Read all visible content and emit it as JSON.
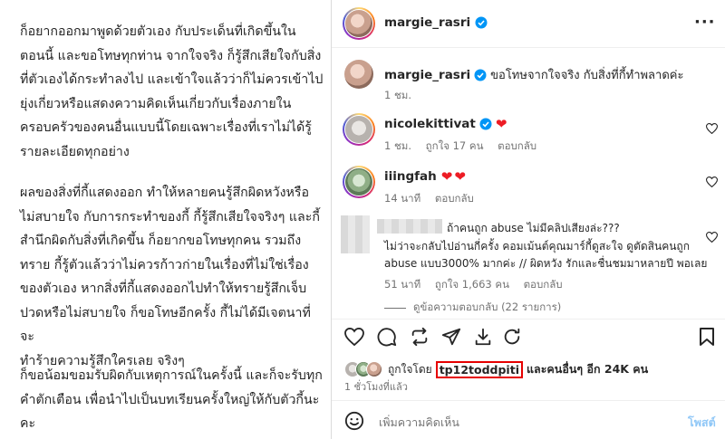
{
  "caption": {
    "paragraphs": [
      "ก็อยากออกมาพูดด้วยตัวเอง  กับประเด็นที่เกิดขึ้นใน\nตอนนี้ และขอโทษทุกท่าน จากใจจริง ก็รู้สึกเสียใจกับสิ่ง\nที่ตัวเองได้กระทำลงไป และเข้าใจแล้วว่าก็ไม่ควรเข้าไป\nยุ่งเกี่ยวหรือแสดงความคิดเห็นเกี่ยวกับเรื่องภายใน\nครอบครัวของคนอื่นแบบนี้โดยเฉพาะเรื่องที่เราไม่ได้รู้\nรายละเอียดทุกอย่าง",
      "ผลของสิ่งที่กี้แสดงออก ทำให้หลายคนรู้สึกผิดหวังหรือ\nไม่สบายใจ กับการกระทำของกี้  กี้รู้สึกเสียใจจริงๆ และกี้\nสำนึกผิดกับสิ่งที่เกิดขึ้น ก็อยากขอโทษทุกคน รวมถึง\nทราย กี้รู้ตัวแล้วว่าไม่ควรก้าวก่ายในเรื่องที่ไม่ใช่เรื่อง\nของตัวเอง หากสิ่งที่กี้แสดงออกไปทำให้ทรายรู้สึกเจ็บ\nปวดหรือไม่สบายใจ ก็ขอโทษอีกครั้ง กี้ไม่ได้มีเจตนาที่จะ\nทำร้ายความรู้สึกใครเลย จริงๆ",
      "ก็ขอน้อมขอมรับผิดกับเหตุการณ์ในครั้งนี้ และก็จะรับทุก\nคำตักเตือน เพื่อนำไปเป็นบทเรียนครั้งใหญ่ให้กับตัวกี้นะ\nคะ"
    ]
  },
  "header": {
    "username": "margie_rasri",
    "more_label": "···"
  },
  "post_caption": {
    "username": "margie_rasri",
    "text": "ขอโทษจากใจจริง กับสิ่งที่กี้ทำพลาดค่ะ",
    "time": "1 ชม."
  },
  "comments": [
    {
      "username": "nicolekittivat",
      "text": "❤",
      "time": "1 ชม.",
      "likes": "ถูกใจ 17 คน",
      "reply": "ตอบกลับ"
    },
    {
      "username": "iiingfah",
      "text": "❤❤",
      "time": "14 นาที",
      "reply": "ตอบกลับ"
    },
    {
      "text_line1": "ถ้าคนถูก abuse ไม่มีคลิปเสียงล่ะ???",
      "text_line2": "ไม่ว่าจะกลับไปอ่านกี่ครั้ง คอมเม้นต์คุณมาร์กี้ดูสะใจ ดูตัดสินคนถูก",
      "text_line3": "abuse แบบ3000% มากค่ะ // ผิดหวัง รักและชื่นชมมาหลายปี พอเลย",
      "time": "51 นาที",
      "likes": "ถูกใจ 1,663 คน",
      "reply": "ตอบกลับ",
      "view_replies": "ดูข้อความตอบกลับ (22 รายการ)"
    }
  ],
  "likes": {
    "prefix": "ถูกใจโดย",
    "highlight_user": "tp12toddpiti",
    "suffix": "และคนอื่นๆ อีก 24K คน",
    "time": "1 ชั่วโมงที่แล้ว"
  },
  "composer": {
    "placeholder": "เพิ่มความคิดเห็น",
    "post_label": "โพสต์"
  },
  "colors": {
    "verified": "#0095f6",
    "heart": "#ed4956",
    "highlight_border": "#e60000",
    "post_button": "#8fc7f7"
  }
}
